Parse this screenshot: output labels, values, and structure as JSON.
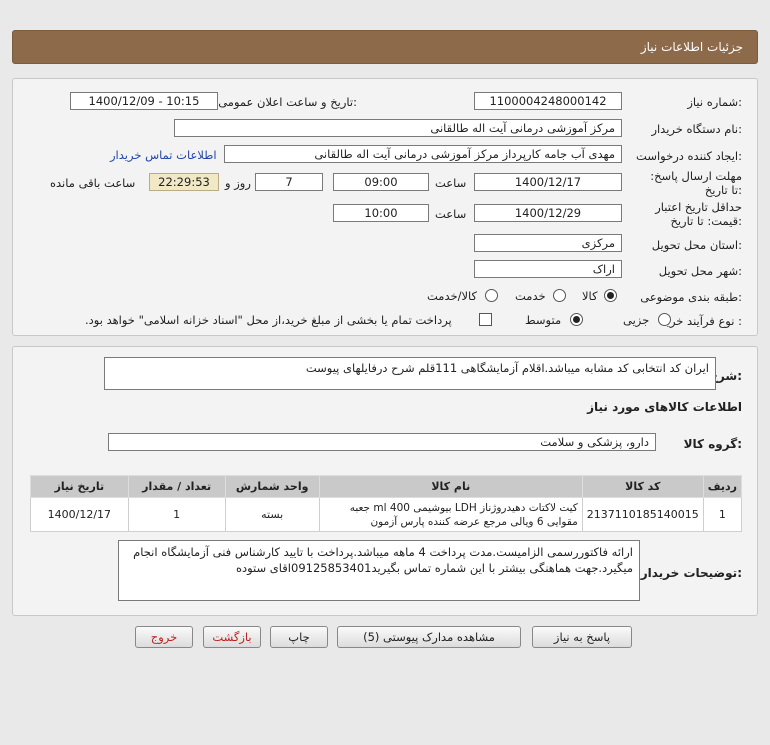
{
  "header": {
    "title": "جزئیات اطلاعات نیاز"
  },
  "form": {
    "need_number_label": "شماره نیاز:",
    "need_number": "1100004248000142",
    "announce_label": "تاریخ و ساعت اعلان عمومی:",
    "announce_value": "1400/12/09 - 10:15",
    "buyer_org_label": "نام دستگاه خریدار:",
    "buyer_org": "مرکز آموزشی  درمانی آیت اله طالقانی",
    "creator_label": "ایجاد کننده درخواست:",
    "creator": "مهدی آب جامه کارپرداز مرکز آموزشی  درمانی آیت اله طالقانی",
    "contact_link": "اطلاعات تماس خریدار",
    "reply_deadline_label": "مهلت ارسال پاسخ: تا تاریخ:",
    "reply_date": "1400/12/17",
    "time_label": "ساعت",
    "reply_time": "09:00",
    "days_value": "7",
    "days_label": "روز و",
    "remaining_time": "22:29:53",
    "remaining_label": "ساعت باقی مانده",
    "price_validity_label": "حداقل تاریخ اعتبار قیمت: تا تاریخ:",
    "validity_date": "1400/12/29",
    "validity_time_label": "ساعت",
    "validity_time": "10:00",
    "province_label": "استان محل تحویل:",
    "province": "مرکزی",
    "city_label": "شهر محل تحویل:",
    "city": "اراک",
    "category_label": "طبقه بندی موضوعی:",
    "category_options": [
      "کالا",
      "خدمت",
      "کالا/خدمت"
    ],
    "process_label": "نوع فرآیند خرید :",
    "process_options": [
      "جزیی",
      "متوسط"
    ],
    "treasury_note": "پرداخت تمام یا بخشی از مبلغ خرید،از محل \"اسناد خزانه اسلامی\" خواهد بود."
  },
  "description": {
    "label": "شرح کلی نیاز:",
    "text": "ایران کد انتخابی کد مشابه میباشد.اقلام آزمایشگاهی 111قلم شرح درفایلهای پیوست"
  },
  "goods": {
    "section_title": "اطلاعات کالاهای مورد نیاز",
    "group_label": "گروه کالا:",
    "group_value": "دارو، پزشکی و سلامت",
    "columns": [
      "ردیف",
      "کد کالا",
      "نام کالا",
      "واحد شمارش",
      "تعداد / مقدار",
      "تاریخ نیاز"
    ],
    "rows": [
      {
        "row": "1",
        "code": "2137110185140015",
        "name": "کیت لاکتات دهیدروژناز LDH بیوشیمی 400 ml جعبه مقوایی 6 ویالی مرجع عرضه کننده پارس آزمون",
        "unit": "بسته",
        "qty": "1",
        "date": "1400/12/17"
      }
    ]
  },
  "buyer_notes": {
    "label": "توضیحات خریدار:",
    "text": "ارائه فاکتوررسمی الزامیست.مدت پرداخت 4 ماهه میباشد.پرداخت با تایید کارشناس فنی آزمایشگاه انجام میگیرد.جهت هماهنگی بیشتر با این شماره تماس بگیرید09125853401اقای ستوده"
  },
  "buttons": {
    "reply": "پاسخ به نیاز",
    "attachments": "مشاهده مدارک پیوستی (5)",
    "print": "چاپ",
    "back": "بازگشت",
    "exit": "خروج"
  },
  "colors": {
    "header_bg": "#8c6a4a",
    "table_header_bg": "#c9c9c9",
    "remaining_bg": "#f1e8c6"
  }
}
